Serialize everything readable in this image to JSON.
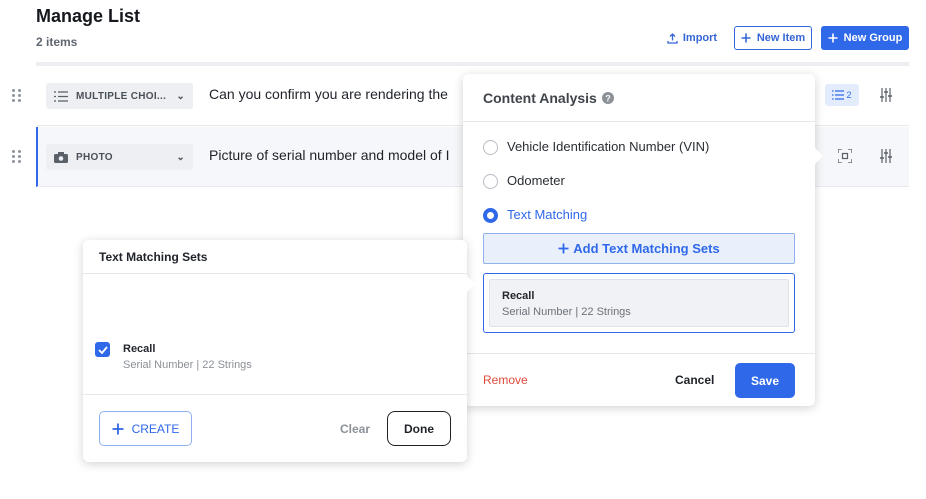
{
  "header": {
    "title": "Manage List",
    "count": "2 items",
    "import_label": "Import",
    "new_item_label": "New Item",
    "new_group_label": "New Group"
  },
  "rows": [
    {
      "type_label": "MULTIPLE CHOI...",
      "type_icon": "list-icon",
      "question": "Can you confirm you are rendering the",
      "badge": "2"
    },
    {
      "type_label": "PHOTO",
      "type_icon": "camera-icon",
      "question": "Picture of serial number and model of I"
    }
  ],
  "content_analysis": {
    "title": "Content Analysis",
    "options": [
      {
        "label": "Vehicle Identification Number (VIN)",
        "selected": false
      },
      {
        "label": "Odometer",
        "selected": false
      },
      {
        "label": "Text Matching",
        "selected": true
      }
    ],
    "add_sets_label": "Add Text Matching Sets",
    "selected_set": {
      "name": "Recall",
      "meta": "Serial Number | 22 Strings"
    },
    "remove_label": "Remove",
    "cancel_label": "Cancel",
    "save_label": "Save"
  },
  "text_matching_sets": {
    "title": "Text Matching Sets",
    "items": [
      {
        "name": "Recall",
        "meta": "Serial Number | 22 Strings",
        "checked": true
      }
    ],
    "create_label": "CREATE",
    "clear_label": "Clear",
    "done_label": "Done"
  },
  "colors": {
    "accent": "#2f68e9",
    "danger": "#df4b3a"
  }
}
